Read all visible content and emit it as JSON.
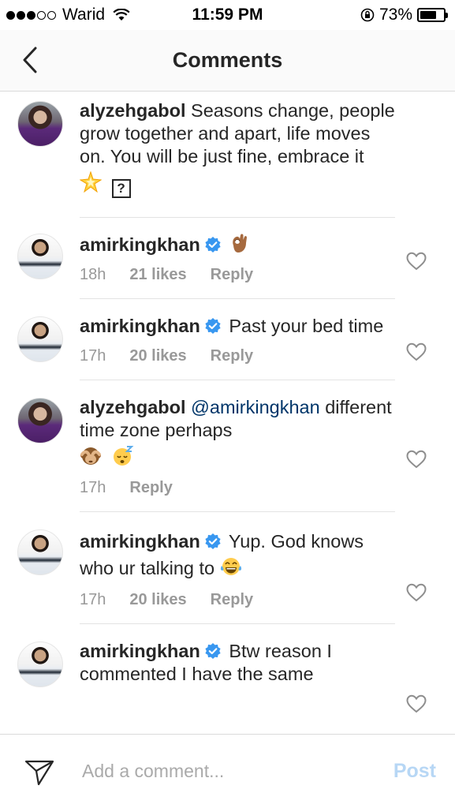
{
  "status_bar": {
    "carrier": "Warid",
    "time": "11:59 PM",
    "battery": "73%",
    "battery_level": 0.73,
    "signal_bars": 3,
    "signal_total": 5
  },
  "nav": {
    "title": "Comments"
  },
  "comments": [
    {
      "username": "alyzehgabol",
      "verified": false,
      "text": "Seasons change, people grow together and apart, life moves on. You will be just fine, embrace it",
      "emojis": [
        "sparkle-star-emoji",
        "unknown-glyph-box"
      ],
      "unknown_glyph": "?",
      "time": "",
      "likes": "",
      "reply": ""
    },
    {
      "username": "amirkingkhan",
      "verified": true,
      "text": "",
      "emojis": [
        "ok-hand-emoji"
      ],
      "time": "18h",
      "likes": "21 likes",
      "reply": "Reply"
    },
    {
      "username": "amirkingkhan",
      "verified": true,
      "text": "Past your bed time",
      "time": "17h",
      "likes": "20 likes",
      "reply": "Reply"
    },
    {
      "username": "alyzehgabol",
      "verified": false,
      "mention": "@amirkingkhan",
      "text": "different time zone perhaps",
      "emojis": [
        "see-no-evil-monkey-emoji",
        "sleeping-face-emoji"
      ],
      "time": "17h",
      "reply": "Reply"
    },
    {
      "username": "amirkingkhan",
      "verified": true,
      "text": "Yup. God knows who ur talking to",
      "emojis": [
        "tears-of-joy-emoji"
      ],
      "time": "17h",
      "likes": "20 likes",
      "reply": "Reply"
    },
    {
      "username": "amirkingkhan",
      "verified": true,
      "text": "Btw reason I commented I have the same"
    }
  ],
  "composer": {
    "placeholder": "Add a comment...",
    "post_label": "Post"
  },
  "colors": {
    "text": "#262626",
    "meta": "#999999",
    "mention": "#003569",
    "verified": "#3897f0",
    "post_disabled": "#b7d7f5"
  },
  "icons": {
    "back": "chevron-left-icon",
    "heart": "heart-outline-icon",
    "send": "paper-plane-icon",
    "verified": "verified-badge-icon"
  }
}
